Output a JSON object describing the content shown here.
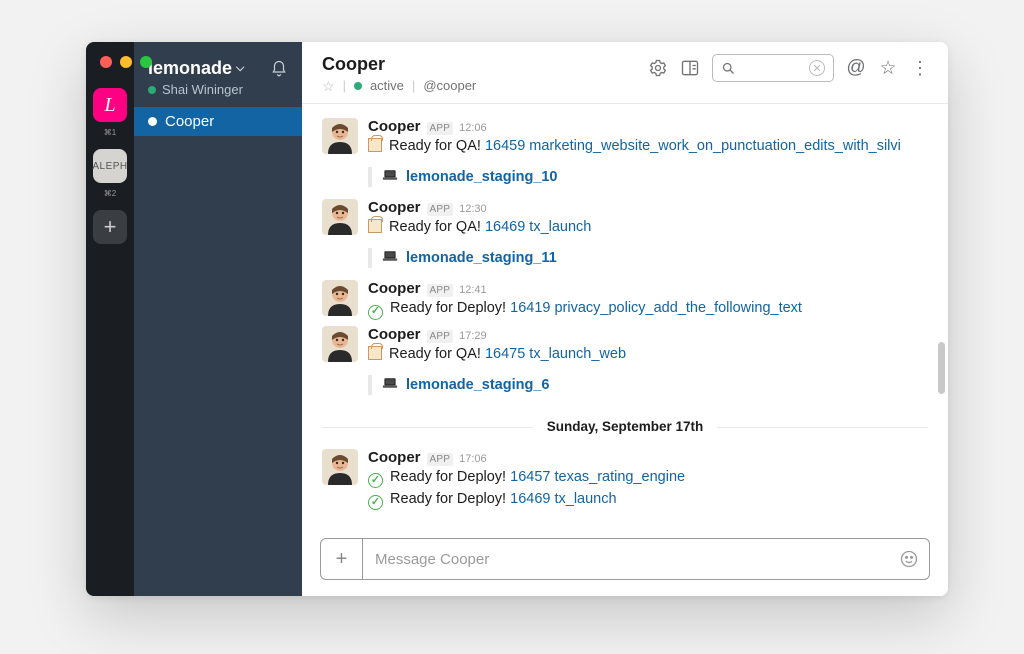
{
  "workspaces": {
    "ws1_glyph": "L",
    "ws1_short": "⌘1",
    "ws2_label": "ALEPH",
    "ws2_short": "⌘2",
    "add_glyph": "+"
  },
  "sidebar": {
    "team": "lemonade",
    "user": "Shai Wininger",
    "items": [
      {
        "label": "Cooper",
        "selected": true
      }
    ]
  },
  "header": {
    "title": "Cooper",
    "status_label": "active",
    "handle": "@cooper",
    "search_placeholder": ""
  },
  "day_separator": "Sunday, September 17th",
  "messages": [
    {
      "user": "Cooper",
      "badge": "APP",
      "time": "12:06",
      "kind": "qa",
      "prefix": "Ready for QA! ",
      "link": "16459 marketing_website_work_on_punctuation_edits_with_silvi",
      "attachment": "lemonade_staging_10"
    },
    {
      "user": "Cooper",
      "badge": "APP",
      "time": "12:30",
      "kind": "qa",
      "prefix": "Ready for QA! ",
      "link": "16469 tx_launch",
      "attachment": "lemonade_staging_11"
    },
    {
      "user": "Cooper",
      "badge": "APP",
      "time": "12:41",
      "kind": "deploy",
      "prefix": "Ready for Deploy! ",
      "link": "16419 privacy_policy_add_the_following_text"
    },
    {
      "user": "Cooper",
      "badge": "APP",
      "time": "17:29",
      "kind": "qa",
      "prefix": "Ready for QA! ",
      "link": "16475 tx_launch_web",
      "attachment": "lemonade_staging_6"
    }
  ],
  "messages_after": [
    {
      "user": "Cooper",
      "badge": "APP",
      "time": "17:06",
      "lines": [
        {
          "kind": "deploy",
          "prefix": "Ready for Deploy! ",
          "link": "16457 texas_rating_engine"
        },
        {
          "kind": "deploy",
          "prefix": "Ready for Deploy! ",
          "link": "16469 tx_launch"
        }
      ]
    }
  ],
  "composer": {
    "placeholder": "Message Cooper"
  }
}
